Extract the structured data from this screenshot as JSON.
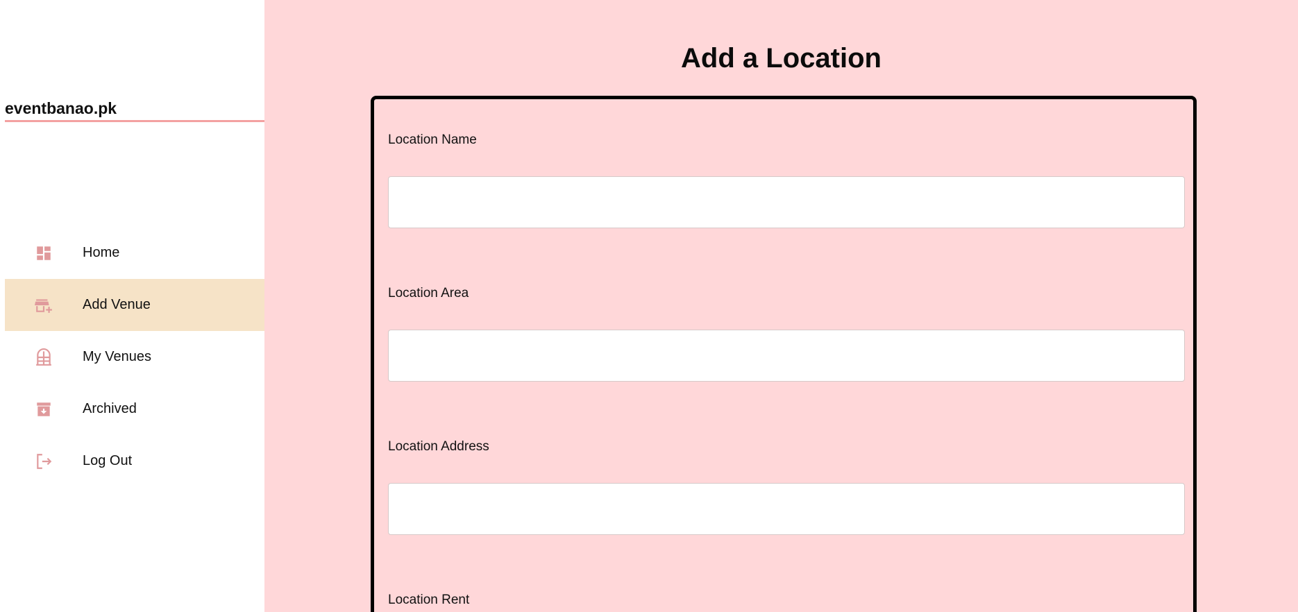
{
  "sidebar": {
    "brand": "eventbanao.pk",
    "items": [
      {
        "label": "Home",
        "icon": "dashboard-icon",
        "active": false
      },
      {
        "label": "Add Venue",
        "icon": "add-business-icon",
        "active": true
      },
      {
        "label": "My Venues",
        "icon": "venue-building-icon",
        "active": false
      },
      {
        "label": "Archived",
        "icon": "archive-icon",
        "active": false
      },
      {
        "label": "Log Out",
        "icon": "logout-icon",
        "active": false
      }
    ]
  },
  "main": {
    "title": "Add a Location",
    "fields": [
      {
        "label": "Location Name",
        "value": "",
        "placeholder": ""
      },
      {
        "label": "Location Area",
        "value": "",
        "placeholder": ""
      },
      {
        "label": "Location Address",
        "value": "",
        "placeholder": ""
      },
      {
        "label": "Location Rent",
        "value": "",
        "placeholder": ""
      }
    ]
  },
  "colors": {
    "accent": "#e09a9c",
    "main_background": "#ffd7d9",
    "active_item": "#f6e3c7",
    "brand_underline": "#f3a1a1"
  }
}
